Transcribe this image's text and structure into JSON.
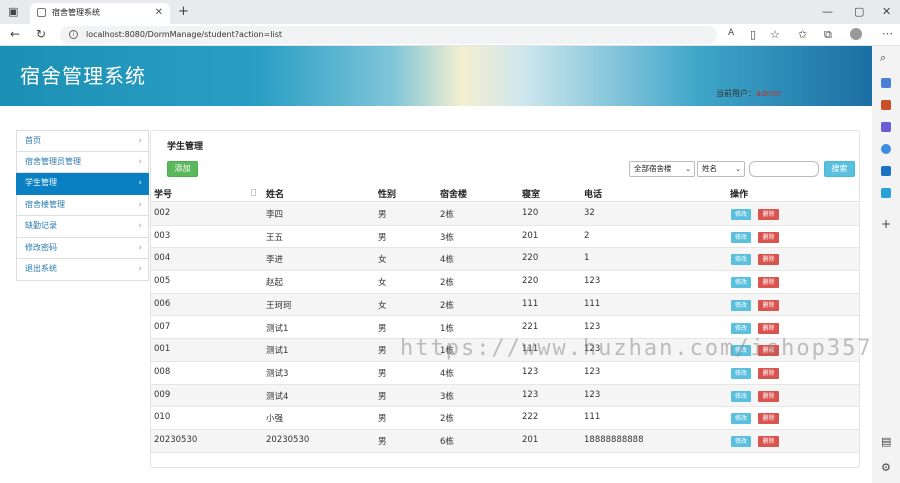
{
  "browser": {
    "tab_title": "宿舍管理系统",
    "url": "localhost:8080/DormManage/student?action=list"
  },
  "header": {
    "title": "宿舍管理系统",
    "user_label": "当前用户：",
    "username": "admin"
  },
  "sidebar": {
    "items": [
      {
        "label": "首页"
      },
      {
        "label": "宿舍管理员管理"
      },
      {
        "label": "学生管理"
      },
      {
        "label": "宿舍楼管理"
      },
      {
        "label": "缺勤记录"
      },
      {
        "label": "修改密码"
      },
      {
        "label": "退出系统"
      }
    ],
    "active_index": 2
  },
  "panel": {
    "title": "学生管理",
    "add_label": "添加",
    "building_filter": "全部宿舍楼",
    "field_filter": "姓名",
    "search_value": "",
    "search_label": "搜索"
  },
  "table": {
    "columns": [
      "学号",
      "姓名",
      "性别",
      "宿舍楼",
      "寝室",
      "电话",
      "操作"
    ],
    "edit_label": "修改",
    "delete_label": "删除",
    "rows": [
      [
        "002",
        "李四",
        "男",
        "2栋",
        "120",
        "32"
      ],
      [
        "003",
        "王五",
        "男",
        "3栋",
        "201",
        "2"
      ],
      [
        "004",
        "李进",
        "女",
        "4栋",
        "220",
        "1"
      ],
      [
        "005",
        "赵起",
        "女",
        "2栋",
        "220",
        "123"
      ],
      [
        "006",
        "王珂珂",
        "女",
        "2栋",
        "111",
        "111"
      ],
      [
        "007",
        "测试1",
        "男",
        "1栋",
        "221",
        "123"
      ],
      [
        "001",
        "测试1",
        "男",
        "1栋",
        "111",
        "123"
      ],
      [
        "008",
        "测试3",
        "男",
        "4栋",
        "123",
        "123"
      ],
      [
        "009",
        "测试4",
        "男",
        "3栋",
        "123",
        "123"
      ],
      [
        "010",
        "小强",
        "男",
        "2栋",
        "222",
        "111"
      ],
      [
        "20230530",
        "20230530",
        "男",
        "6栋",
        "201",
        "18888888888"
      ]
    ]
  },
  "watermark": "https://www.huzhan.com/ishop3572",
  "colors": {
    "active_nav": "#0a7fc2",
    "add_button": "#5cb85c",
    "edit_button": "#5bc0de",
    "delete_button": "#d9534f",
    "username": "#c0302a"
  }
}
